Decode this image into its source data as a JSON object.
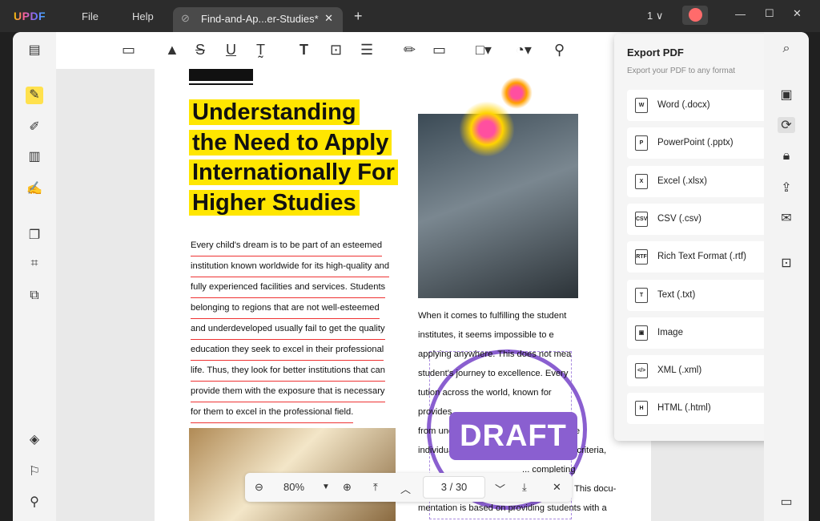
{
  "app": {
    "logo": "UPDF",
    "menu": [
      "File",
      "Help"
    ],
    "tab_title": "Find-and-Ap...er-Studies*",
    "page_indicator": "1"
  },
  "doc": {
    "heading": [
      "Understanding",
      "the Need to Apply",
      "Internationally For",
      "Higher Studies"
    ],
    "left_para": [
      "Every child's dream is to be part of an esteemed",
      "institution known worldwide for its high-quality and",
      "fully experienced facilities and services. Students",
      "belonging to regions that are not well-esteemed",
      "and underdeveloped usually fail to get the quality",
      "education they seek to excel in their professional",
      "life. Thus, they look for better institutions that can",
      "provide them with the exposure that is necessary",
      "for them to excel in the professional field."
    ],
    "right_para": [
      "When it comes to fulfilling the student",
      "institutes, it seems impossible to e",
      "applying anywhere. This does not mea",
      "student's journey to excellence. Every",
      "tution across the world, known for",
      "provides",
      "from underdeveloped regions ... possible",
      "individual is eligible through the defined criteria,",
      "... completing",
      "their education at a renowned institute. This docu-",
      "mentation is based on providing students with a"
    ],
    "stamp": "DRAFT"
  },
  "export": {
    "title": "Export PDF",
    "subtitle": "Export your PDF to any format",
    "options": [
      {
        "label": "Word (.docx)",
        "icon": "W"
      },
      {
        "label": "PowerPoint (.pptx)",
        "icon": "P"
      },
      {
        "label": "Excel (.xlsx)",
        "icon": "X"
      },
      {
        "label": "CSV (.csv)",
        "icon": "CSV"
      },
      {
        "label": "Rich Text Format (.rtf)",
        "icon": "RTF"
      },
      {
        "label": "Text (.txt)",
        "icon": "T"
      },
      {
        "label": "Image",
        "icon": "▣"
      },
      {
        "label": "XML (.xml)",
        "icon": "</>"
      },
      {
        "label": "HTML (.html)",
        "icon": "H"
      }
    ]
  },
  "pager": {
    "zoom": "80%",
    "current": "3",
    "total": "30",
    "sep": "/"
  },
  "colors": {
    "accent": "#8a5fd0",
    "highlight": "#ffe600"
  }
}
